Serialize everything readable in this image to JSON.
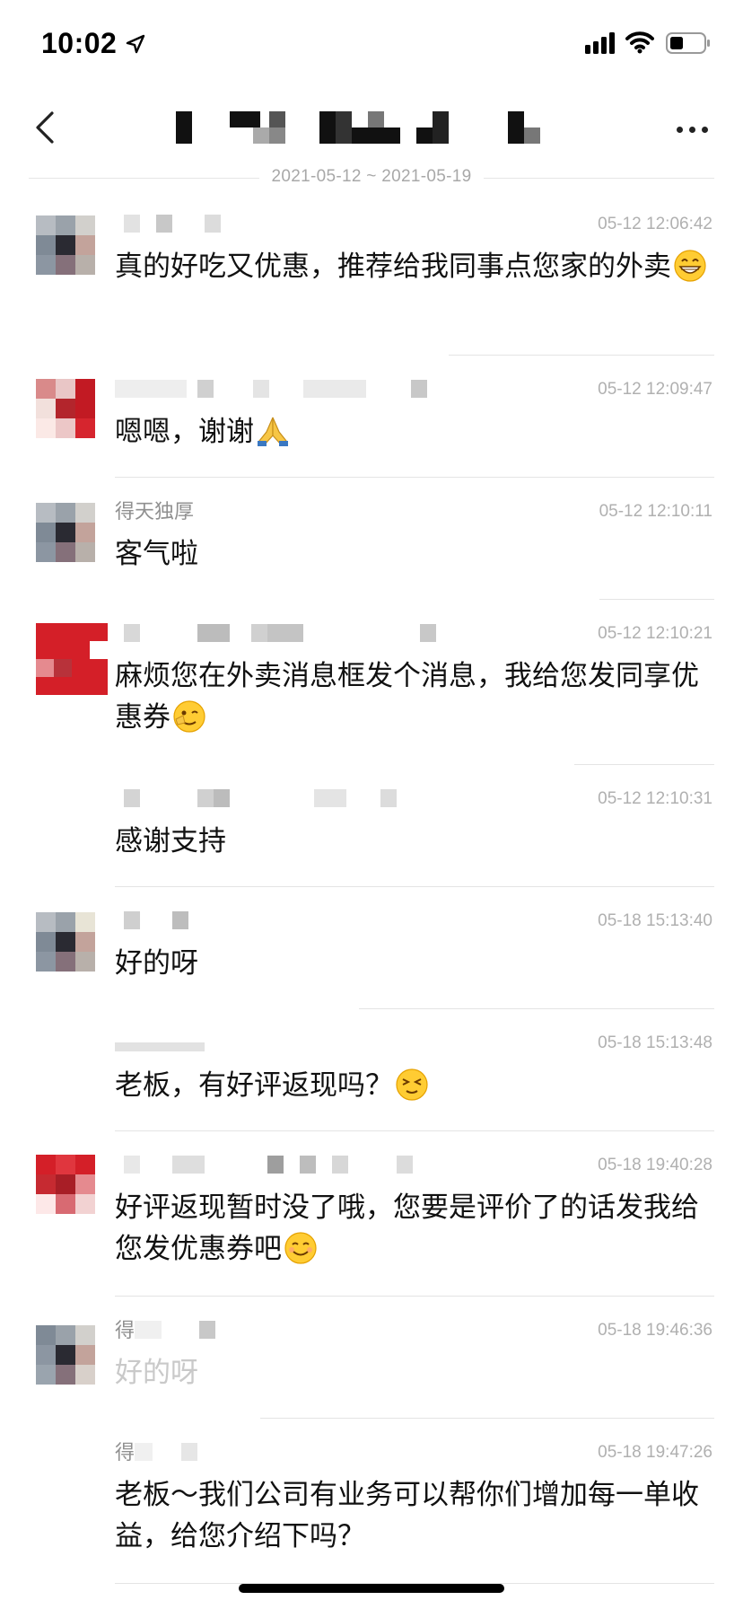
{
  "status_bar": {
    "time": "10:02"
  },
  "nav": {
    "date_range": "2021-05-12 ~ 2021-05-19"
  },
  "messages": [
    {
      "name": "",
      "timestamp": "05-12 12:06:42",
      "text": "真的好吃又优惠，推荐给我同事点您家的外卖",
      "emoji": "grin-emoji"
    },
    {
      "name": "",
      "timestamp": "05-12 12:09:47",
      "text": "嗯嗯，谢谢",
      "emoji": "pray-emoji"
    },
    {
      "name": "得天独厚",
      "timestamp": "05-12 12:10:11",
      "text": "客气啦",
      "emoji": ""
    },
    {
      "name": "",
      "timestamp": "05-12 12:10:21",
      "text": "麻烦您在外卖消息框发个消息，我给您发同享优惠券",
      "emoji": "wink-emoji"
    },
    {
      "name": "",
      "timestamp": "05-12 12:10:31",
      "text": "感谢支持",
      "emoji": ""
    },
    {
      "name": "",
      "timestamp": "05-18 15:13:40",
      "text": "好的呀",
      "emoji": ""
    },
    {
      "name": "",
      "timestamp": "05-18 15:13:48",
      "text": "老板，有好评返现吗？",
      "emoji": "squint-emoji"
    },
    {
      "name": "",
      "timestamp": "05-18 19:40:28",
      "text": "好评返现暂时没了哦，您要是评价了的话发我给您发优惠券吧",
      "emoji": "smile-emoji"
    },
    {
      "name": "得",
      "timestamp": "05-18 19:46:36",
      "text": "好的呀",
      "emoji": ""
    },
    {
      "name": "得",
      "timestamp": "05-18 19:47:26",
      "text": "老板～我们公司有业务可以帮你们增加每一单收益，给您介绍下吗？",
      "emoji": ""
    }
  ]
}
